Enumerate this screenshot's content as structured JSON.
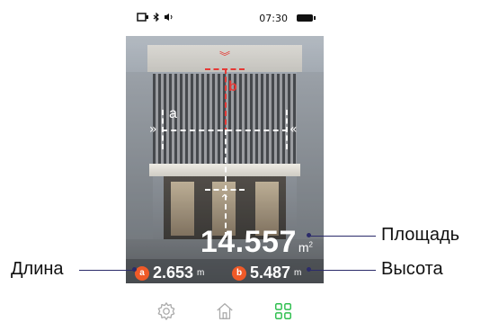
{
  "status_bar": {
    "time": "07:30"
  },
  "overlay": {
    "label_a": "a",
    "label_b": "b"
  },
  "readout": {
    "area_value": "14.557",
    "area_unit": "m",
    "area_unit_sup": "2",
    "length_badge": "a",
    "length_value": "2.653",
    "length_unit": "m",
    "height_badge": "b",
    "height_value": "5.487",
    "height_unit": "m"
  },
  "callouts": {
    "area": "Площадь",
    "length": "Длина",
    "height": "Высота"
  },
  "tabs": [
    {
      "icon": "gear-icon"
    },
    {
      "icon": "home-icon"
    },
    {
      "icon": "apps-grid-icon"
    }
  ],
  "colors": {
    "accent_red": "#e53935",
    "badge_orange": "#f05a28",
    "active_tab_green": "#2fbf4f",
    "callout_line": "#2b2b6a"
  }
}
